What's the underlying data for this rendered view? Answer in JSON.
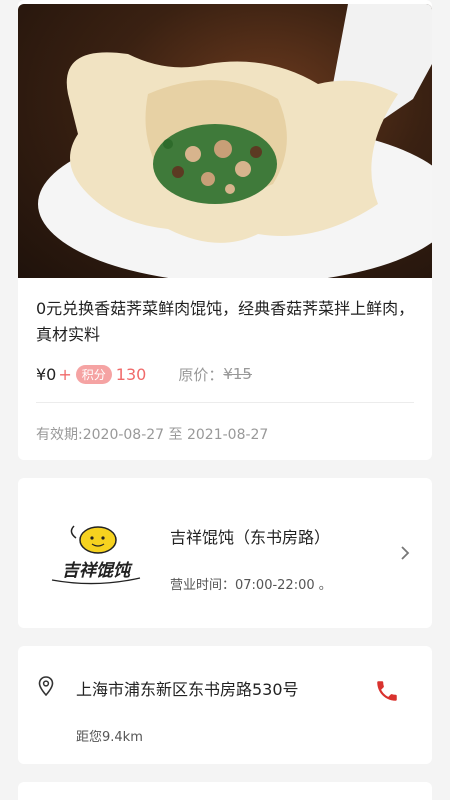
{
  "product": {
    "image_alt": "dumpling on spoon",
    "title": "0元兑换香菇荠菜鲜肉馄饨，经典香菇荠菜拌上鲜肉，真材实料",
    "price": "¥0",
    "plus": "+",
    "points_badge": "积分",
    "points_value": "130",
    "original_label": "原价：",
    "original_value": "¥15",
    "validity": "有效期:2020-08-27 至 2021-08-27"
  },
  "store": {
    "logo_text": "吉祥馄饨",
    "name": "吉祥馄饨（东书房路）",
    "hours": "营业时间：07:00-22:00 。"
  },
  "address": {
    "text": "上海市浦东新区东书房路530号",
    "distance": "距您9.4km"
  },
  "colors": {
    "accent": "#f06a6a",
    "badge": "#f5a3a3",
    "phone": "#d9322e"
  }
}
